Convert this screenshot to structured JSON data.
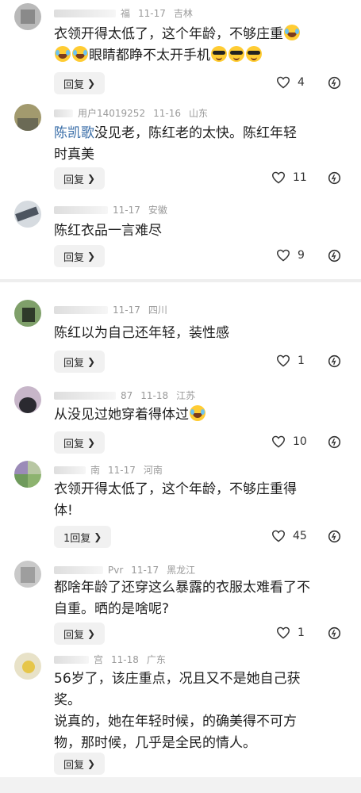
{
  "comments": [
    {
      "name_suffix": "福",
      "date": "11-17",
      "location": "吉林",
      "text_line1": "衣领开得太低了，这个年龄，不够庄重",
      "text_line2": "眼睛都睁不太开手机",
      "reply": "回复",
      "likes": "4",
      "emoji_icons": [
        "laughing-tears-icon",
        "laughing-tears-icon",
        "laughing-tears-icon",
        "sunglasses-icon",
        "sunglasses-icon",
        "sunglasses-icon"
      ]
    },
    {
      "name_suffix": "用户14019252",
      "date": "11-16",
      "location": "山东",
      "mention": "陈凯歌",
      "text_line1": "没见老，陈红老的太快。陈红年轻",
      "text_line2": "时真美",
      "reply": "回复",
      "likes": "11"
    },
    {
      "name_suffix": "",
      "date": "11-17",
      "location": "安徽",
      "text_line1": "陈红衣品一言难尽",
      "reply": "回复",
      "likes": "9"
    },
    {
      "name_suffix": "",
      "date": "11-17",
      "location": "四川",
      "text_line1": "陈红以为自己还年轻，装性感",
      "reply": "回复",
      "likes": "1"
    },
    {
      "name_suffix": "87",
      "date": "11-18",
      "location": "江苏",
      "text_line1": "从没见过她穿着得体过",
      "reply": "回复",
      "likes": "10"
    },
    {
      "name_suffix": "南",
      "date": "11-17",
      "location": "河南",
      "text_line1": "衣领开得太低了，这个年龄，不够庄重得",
      "text_line2": "体!",
      "reply": "1回复",
      "likes": "45"
    },
    {
      "name_suffix": "",
      "date": "11-17",
      "location": "黑龙江",
      "text_line1": "都啥年龄了还穿这么暴露的衣服太难看了不",
      "text_line2": "自重。晒的是啥呢?",
      "reply": "回复",
      "likes": "1"
    },
    {
      "name_suffix": "宫",
      "date": "11-18",
      "location": "广东",
      "text_line1": "56岁了，该庄重点，况且又不是她自己获",
      "text_line2": "奖。",
      "text_line3": "说真的，她在年轻时候，的确美得不可方",
      "text_line4": "物，那时候，几乎是全民的情人。",
      "reply": "回复"
    }
  ],
  "colors": {
    "meta": "#9a9a9a",
    "mention": "#3a6ea8",
    "background": "#f2f2f2"
  }
}
